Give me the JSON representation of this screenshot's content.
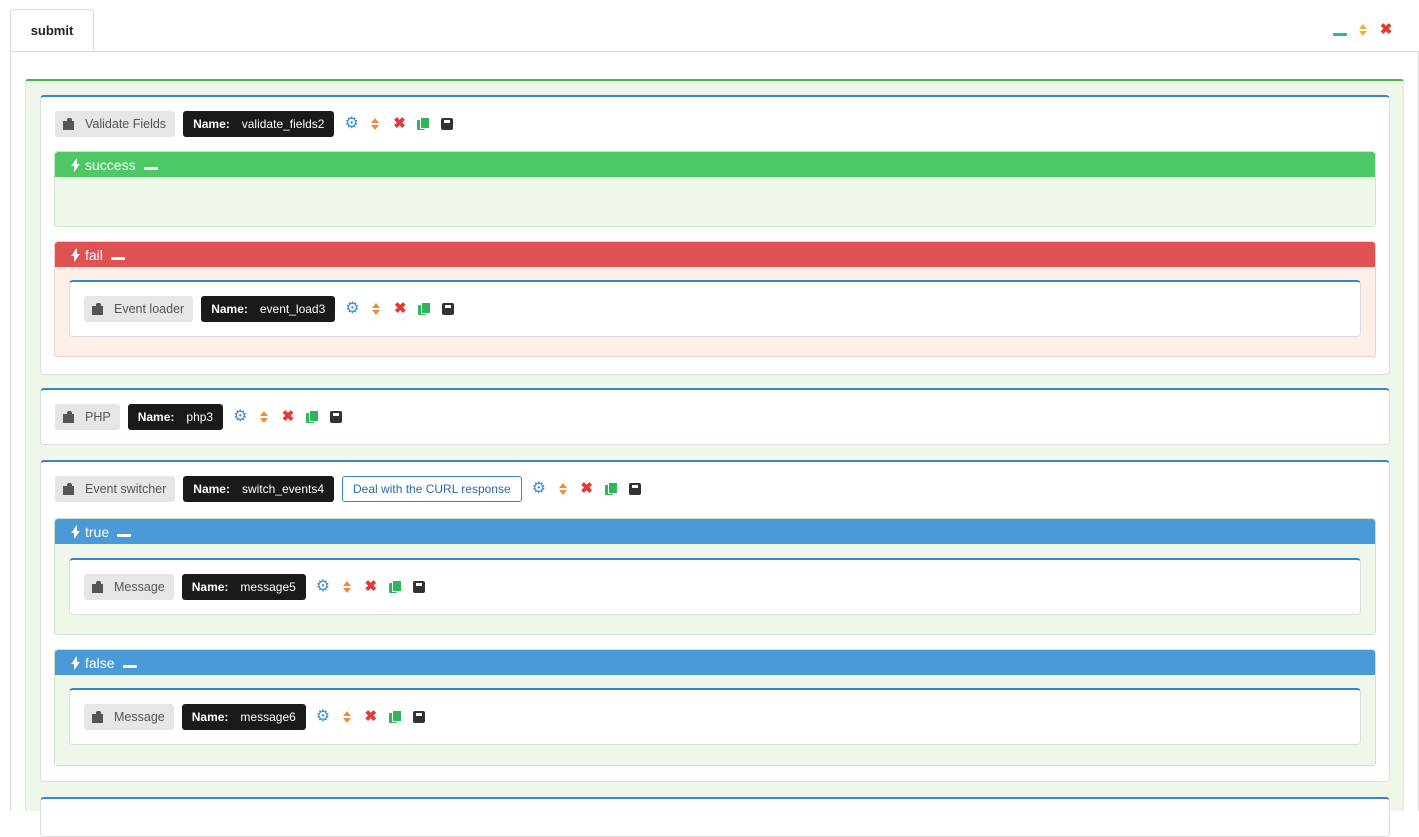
{
  "tab": {
    "label": "submit"
  },
  "window_controls": {
    "minimize": "minimize-icon",
    "sort": "sort-icon",
    "close": "close-icon"
  },
  "colors": {
    "accent_green": "#4cc964",
    "accent_red": "#e05252",
    "accent_blue": "#4a9ad8",
    "block_border": "#3a87c8"
  },
  "blocks": [
    {
      "type": "Validate Fields",
      "name_label": "Name:",
      "name": "validate_fields2"
    },
    {
      "type": "Event loader",
      "name_label": "Name:",
      "name": "event_load3"
    },
    {
      "type": "PHP",
      "name_label": "Name:",
      "name": "php3"
    },
    {
      "type": "Event switcher",
      "name_label": "Name:",
      "name": "switch_events4",
      "description": "Deal with the CURL response"
    },
    {
      "type": "Message",
      "name_label": "Name:",
      "name": "message5"
    },
    {
      "type": "Message",
      "name_label": "Name:",
      "name": "message6"
    }
  ],
  "events": [
    {
      "label": "success"
    },
    {
      "label": "fail"
    },
    {
      "label": "true"
    },
    {
      "label": "false"
    }
  ]
}
